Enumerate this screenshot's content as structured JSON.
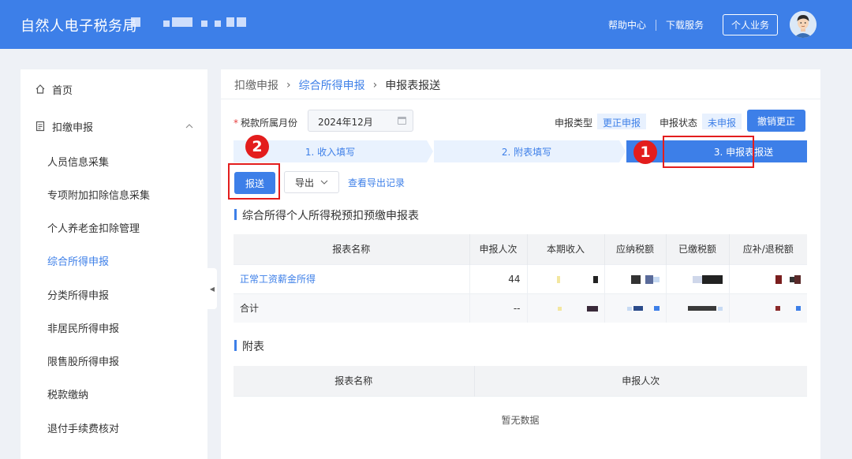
{
  "header": {
    "title": "自然人电子税务局",
    "links": [
      "帮助中心",
      "下载服务"
    ],
    "personal": "个人业务"
  },
  "sidebar": {
    "items": [
      {
        "label": "首页",
        "icon": "home-icon"
      },
      {
        "label": "扣缴申报",
        "icon": "document-icon",
        "expand": "chevron-up-icon"
      },
      {
        "label": "人员信息采集"
      },
      {
        "label": "专项附加扣除信息采集"
      },
      {
        "label": "个人养老金扣除管理"
      },
      {
        "label": "综合所得申报"
      },
      {
        "label": "分类所得申报"
      },
      {
        "label": "非居民所得申报"
      },
      {
        "label": "限售股所得申报"
      },
      {
        "label": "税款缴纳"
      },
      {
        "label": "退付手续费核对"
      }
    ]
  },
  "breadcrumb": [
    "扣缴申报",
    "综合所得申报",
    "申报表报送"
  ],
  "form": {
    "month_label": "税款所属月份",
    "month_value": "2024年12月",
    "type_label": "申报类型",
    "type_value": "更正申报",
    "status_label": "申报状态",
    "status_value": "未申报",
    "revoke_button": "撤销更正"
  },
  "steps": [
    "1. 收入填写",
    "2. 附表填写",
    "3. 申报表报送"
  ],
  "markers": [
    "1",
    "2"
  ],
  "toolbar": {
    "send": "报送",
    "export": "导出",
    "export_log": "查看导出记录"
  },
  "main_table": {
    "title": "综合所得个人所得税预扣预缴申报表",
    "columns": [
      "报表名称",
      "申报人次",
      "本期收入",
      "应纳税额",
      "已缴税额",
      "应补/退税额"
    ],
    "rows": [
      {
        "name": "正常工资薪金所得",
        "count": "44"
      },
      {
        "name": "合计",
        "count": "--"
      }
    ]
  },
  "attach_table": {
    "title": "附表",
    "columns": [
      "报表名称",
      "申报人次"
    ],
    "empty": "暂无数据"
  },
  "colors": {
    "accent": "#3d7fe8",
    "marker": "#e31d1d"
  }
}
